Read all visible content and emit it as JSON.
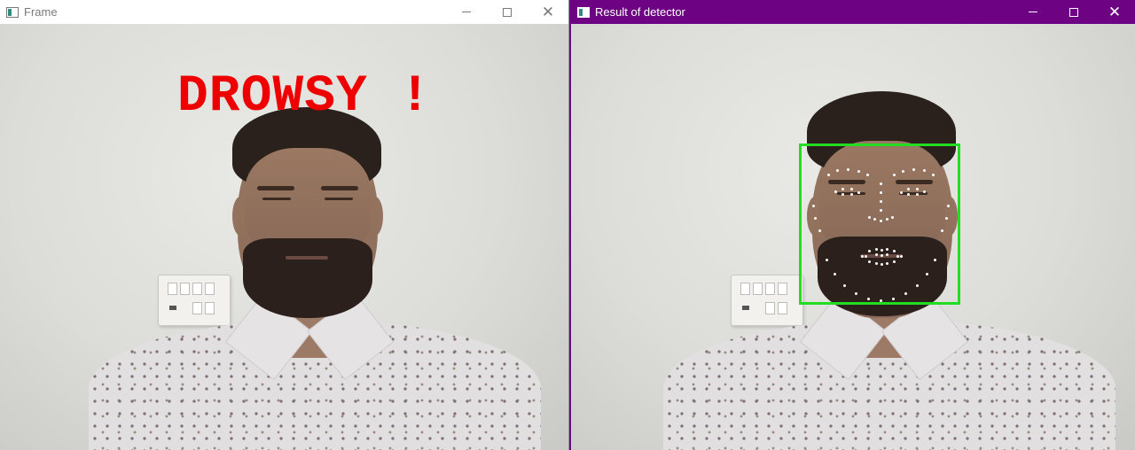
{
  "windows": {
    "frame": {
      "title": "Frame",
      "alert_text": "DROWSY !",
      "alert_color": "#ee0000"
    },
    "result": {
      "title": "Result of detector",
      "titlebar_color": "#6d0383",
      "face_box_color": "#22dd22"
    }
  },
  "controls": {
    "minimize": "minimize-icon",
    "maximize": "maximize-icon",
    "close": "close-icon",
    "close_glyph": "✕"
  }
}
